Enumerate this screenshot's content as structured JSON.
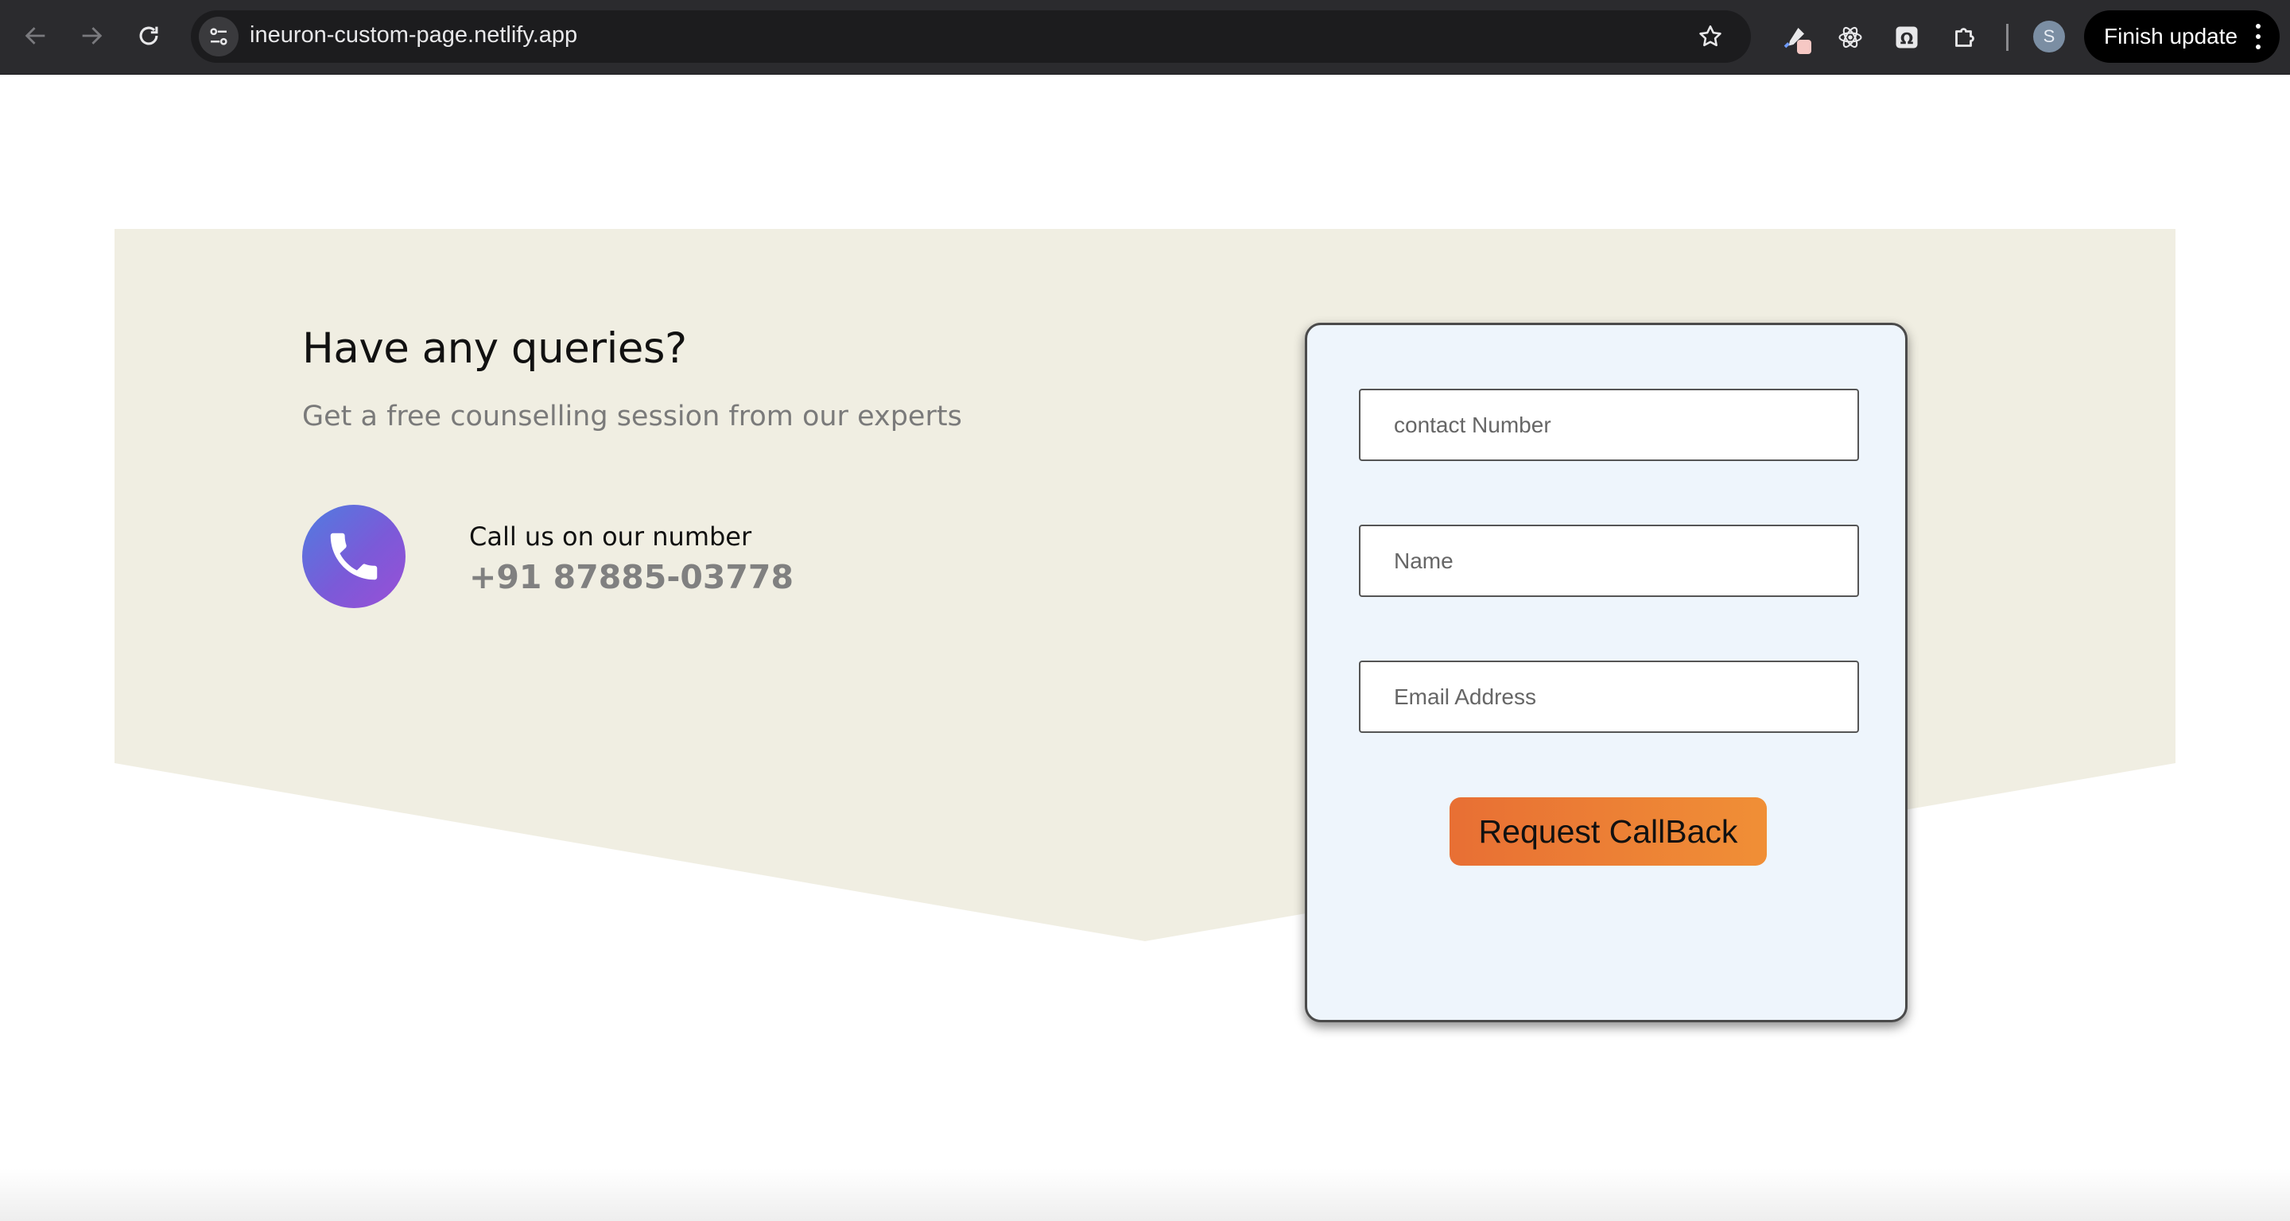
{
  "browser": {
    "url": "ineuron-custom-page.netlify.app",
    "finish_update_label": "Finish update",
    "profile_initial": "S",
    "icons": {
      "back": "back-arrow-icon",
      "forward": "forward-arrow-icon",
      "reload": "reload-icon",
      "site_info": "site-settings-icon",
      "bookmark": "star-icon",
      "extensions": [
        "eyedropper-icon",
        "react-atom-icon",
        "omega-icon",
        "puzzle-piece-icon"
      ],
      "menu": "kebab-menu-icon"
    }
  },
  "page": {
    "heading": "Have any queries?",
    "subheading": "Get a free counselling session from our experts",
    "call": {
      "label": "Call us on our number",
      "number": "+91 87885-03778",
      "icon": "phone-icon"
    },
    "form": {
      "contact_placeholder": "contact Number",
      "name_placeholder": "Name",
      "email_placeholder": "Email Address",
      "submit_label": "Request CallBack"
    },
    "colors": {
      "section_bg": "#f0eee2",
      "card_bg": "#eef5fc",
      "button_start": "#e86f34",
      "button_end": "#f08f36",
      "phone_gradient_start": "#4f7de0",
      "phone_gradient_end": "#9a4fd6"
    }
  }
}
